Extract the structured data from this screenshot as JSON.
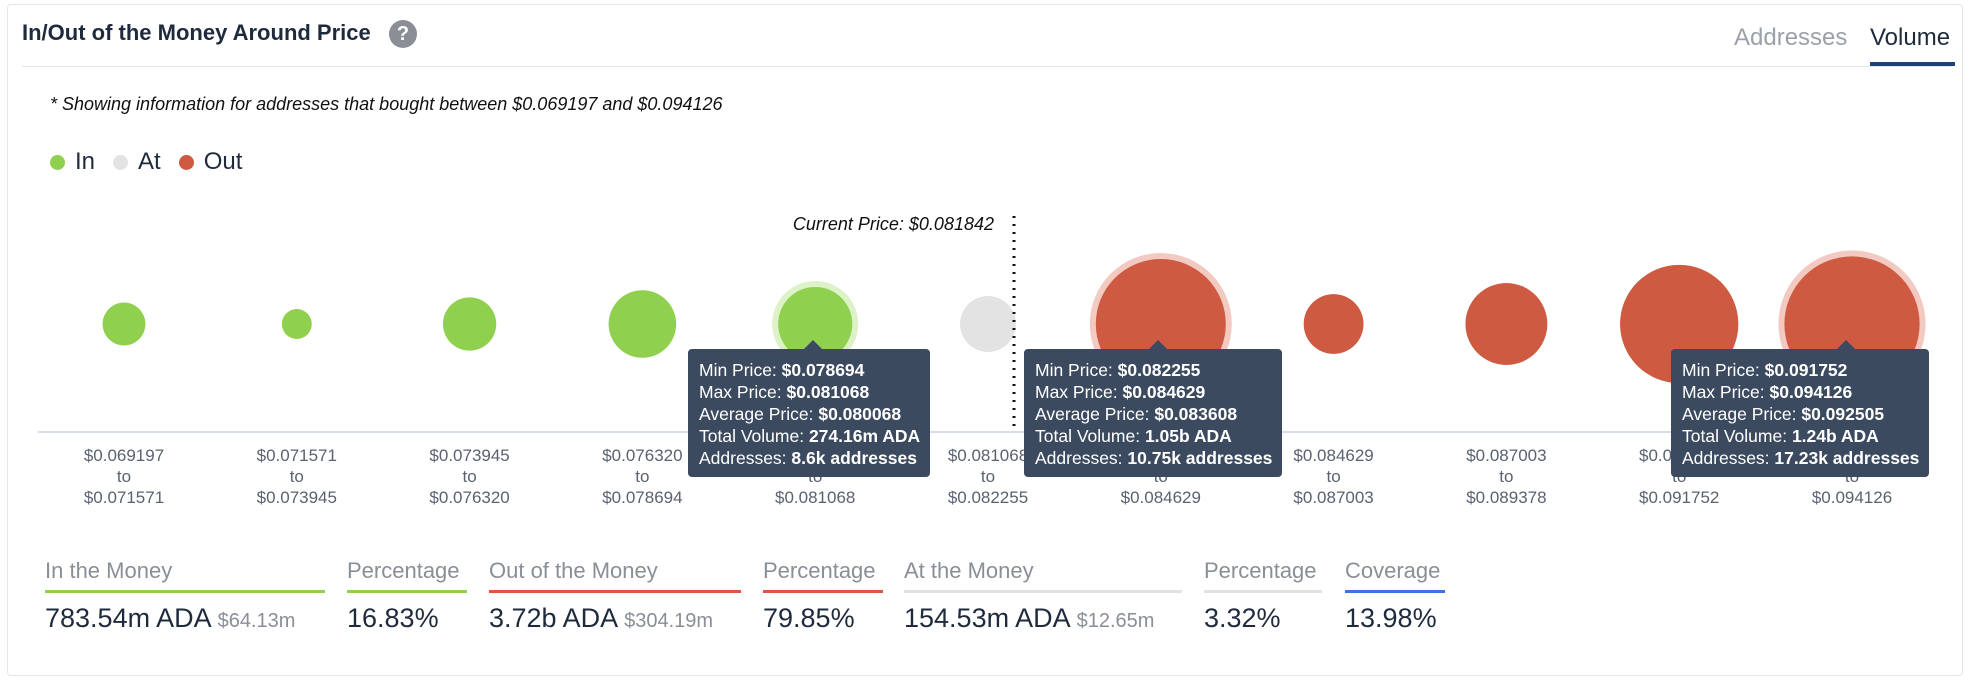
{
  "header": {
    "title": "In/Out of the Money Around Price",
    "help_icon": "?",
    "tabs": [
      {
        "label": "Addresses",
        "active": false
      },
      {
        "label": "Volume",
        "active": true
      }
    ]
  },
  "note": "* Showing information for addresses that bought between $0.069197 and $0.094126",
  "legend": [
    {
      "label": "In",
      "color": "#8fd14f"
    },
    {
      "label": "At",
      "color": "#e3e3e3"
    },
    {
      "label": "Out",
      "color": "#cd5a41"
    }
  ],
  "current_price_label": "Current Price: $0.081842",
  "chart_data": {
    "type": "scatter",
    "categories": [
      {
        "from": "$0.069197",
        "to": "$0.071571",
        "status": "In"
      },
      {
        "from": "$0.071571",
        "to": "$0.073945",
        "status": "In"
      },
      {
        "from": "$0.073945",
        "to": "$0.076320",
        "status": "In"
      },
      {
        "from": "$0.076320",
        "to": "$0.078694",
        "status": "In"
      },
      {
        "from": "$0.078694",
        "to": "$0.081068",
        "status": "In"
      },
      {
        "from": "$0.081068",
        "to": "$0.082255",
        "status": "At"
      },
      {
        "from": "$0.082255",
        "to": "$0.084629",
        "status": "Out"
      },
      {
        "from": "$0.084629",
        "to": "$0.087003",
        "status": "Out"
      },
      {
        "from": "$0.087003",
        "to": "$0.089378",
        "status": "Out"
      },
      {
        "from": "$0.089378",
        "to": "$0.091752",
        "status": "Out"
      },
      {
        "from": "$0.091752",
        "to": "$0.094126",
        "status": "Out"
      }
    ],
    "relative_bubble_size": [
      0.33,
      0.23,
      0.41,
      0.52,
      0.57,
      0.43,
      1.0,
      0.46,
      0.63,
      0.91,
      1.04
    ],
    "current_price_index": 5,
    "legend_position": "top-left",
    "grid": false
  },
  "tooltips": [
    {
      "min_label": "Min Price:",
      "min": "$0.078694",
      "max_label": "Max Price:",
      "max": "$0.081068",
      "avg_label": "Average Price:",
      "avg": "$0.080068",
      "vol_label": "Total Volume:",
      "vol": "274.16m ADA",
      "addr_label": "Addresses:",
      "addr": "8.6k addresses"
    },
    {
      "min_label": "Min Price:",
      "min": "$0.082255",
      "max_label": "Max Price:",
      "max": "$0.084629",
      "avg_label": "Average Price:",
      "avg": "$0.083608",
      "vol_label": "Total Volume:",
      "vol": "1.05b ADA",
      "addr_label": "Addresses:",
      "addr": "10.75k addresses"
    },
    {
      "min_label": "Min Price:",
      "min": "$0.091752",
      "max_label": "Max Price:",
      "max": "$0.094126",
      "avg_label": "Average Price:",
      "avg": "$0.092505",
      "vol_label": "Total Volume:",
      "vol": "1.24b ADA",
      "addr_label": "Addresses:",
      "addr": "17.23k addresses"
    }
  ],
  "summary": [
    {
      "label": "In the Money",
      "value": "783.54m ADA",
      "usd": "$64.13m",
      "color": "#8fd14f"
    },
    {
      "label": "Percentage",
      "value": "16.83%",
      "usd": "",
      "color": "#8fd14f"
    },
    {
      "label": "Out of the Money",
      "value": "3.72b ADA",
      "usd": "$304.19m",
      "color": "#d9573e"
    },
    {
      "label": "Percentage",
      "value": "79.85%",
      "usd": "",
      "color": "#d9573e"
    },
    {
      "label": "At the Money",
      "value": "154.53m ADA",
      "usd": "$12.65m",
      "color": "#e2e2e2"
    },
    {
      "label": "Percentage",
      "value": "3.32%",
      "usd": "",
      "color": "#e2e2e2"
    },
    {
      "label": "Coverage",
      "value": "13.98%",
      "usd": "",
      "color": "#3b73db"
    }
  ]
}
